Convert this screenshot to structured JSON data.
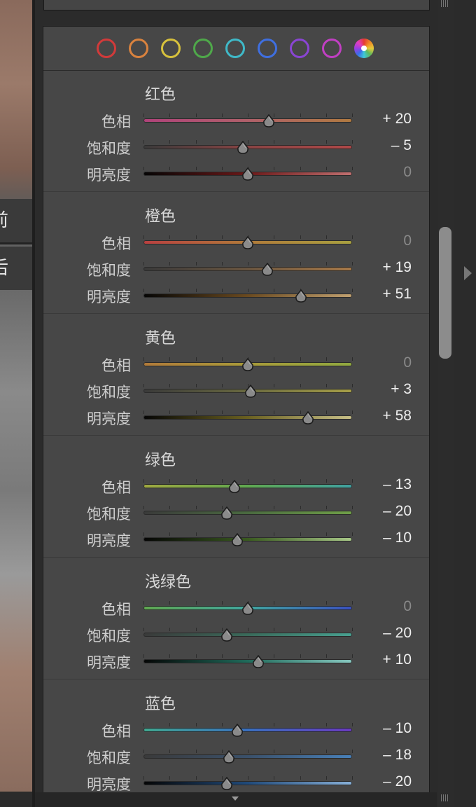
{
  "photo_labels": [
    "前",
    "后"
  ],
  "color_swatches": [
    {
      "name": "red",
      "color": "#d23a3a"
    },
    {
      "name": "orange",
      "color": "#d9823e"
    },
    {
      "name": "yellow",
      "color": "#d7c13c"
    },
    {
      "name": "green",
      "color": "#4fa84a"
    },
    {
      "name": "aqua",
      "color": "#3fb9c8"
    },
    {
      "name": "blue",
      "color": "#3f6fe0"
    },
    {
      "name": "purple",
      "color": "#8a45d4"
    },
    {
      "name": "magenta",
      "color": "#c13fc3"
    },
    {
      "name": "all",
      "color": "conic"
    }
  ],
  "groups": [
    {
      "title": "红色",
      "rows": [
        {
          "label": "色相",
          "value": "+ 20",
          "v": 20,
          "gradient": [
            "#b0427a",
            "#b0606a",
            "#b07a40"
          ]
        },
        {
          "label": "饱和度",
          "value": "– 5",
          "v": -5,
          "gradient": [
            "#3a3a3a",
            "#8a4444",
            "#b04848"
          ]
        },
        {
          "label": "明亮度",
          "value": "0",
          "v": 0,
          "gradient": [
            "#050505",
            "#6a1818",
            "#c07070"
          ]
        }
      ]
    },
    {
      "title": "橙色",
      "rows": [
        {
          "label": "色相",
          "value": "0",
          "v": 0,
          "gradient": [
            "#b84040",
            "#b07a3a",
            "#a8a040"
          ]
        },
        {
          "label": "饱和度",
          "value": "+ 19",
          "v": 19,
          "gradient": [
            "#3a3a3a",
            "#6a5540",
            "#a87a48"
          ]
        },
        {
          "label": "明亮度",
          "value": "+ 51",
          "v": 51,
          "gradient": [
            "#050505",
            "#6a4a20",
            "#c0a070"
          ]
        }
      ]
    },
    {
      "title": "黄色",
      "rows": [
        {
          "label": "色相",
          "value": "0",
          "v": 0,
          "gradient": [
            "#b07a3a",
            "#a89a3a",
            "#90a840"
          ]
        },
        {
          "label": "饱和度",
          "value": "+ 3",
          "v": 3,
          "gradient": [
            "#3a3a3a",
            "#6a6a40",
            "#a8a048"
          ]
        },
        {
          "label": "明亮度",
          "value": "+ 58",
          "v": 58,
          "gradient": [
            "#050505",
            "#6a6020",
            "#c8c088"
          ]
        }
      ]
    },
    {
      "title": "绿色",
      "rows": [
        {
          "label": "色相",
          "value": "– 13",
          "v": -13,
          "gradient": [
            "#a0a840",
            "#60a850",
            "#40a0a0"
          ]
        },
        {
          "label": "饱和度",
          "value": "– 20",
          "v": -20,
          "gradient": [
            "#3a3a3a",
            "#4a6a40",
            "#70a048"
          ]
        },
        {
          "label": "明亮度",
          "value": "– 10",
          "v": -10,
          "gradient": [
            "#050505",
            "#3a5a20",
            "#a8c888"
          ]
        }
      ]
    },
    {
      "title": "浅绿色",
      "rows": [
        {
          "label": "色相",
          "value": "0",
          "v": 0,
          "gradient": [
            "#60a850",
            "#40a8a0",
            "#3a50c0"
          ]
        },
        {
          "label": "饱和度",
          "value": "– 20",
          "v": -20,
          "gradient": [
            "#3a3a3a",
            "#3a6a5a",
            "#48a090"
          ]
        },
        {
          "label": "明亮度",
          "value": "+ 10",
          "v": 10,
          "gradient": [
            "#050505",
            "#206a5a",
            "#88c8c0"
          ]
        }
      ]
    },
    {
      "title": "蓝色",
      "rows": [
        {
          "label": "色相",
          "value": "– 10",
          "v": -10,
          "gradient": [
            "#40a890",
            "#3a70c0",
            "#6a3ac0"
          ]
        },
        {
          "label": "饱和度",
          "value": "– 18",
          "v": -18,
          "gradient": [
            "#3a3a3a",
            "#3a506a",
            "#4880b8"
          ]
        },
        {
          "label": "明亮度",
          "value": "– 20",
          "v": -20,
          "gradient": [
            "#050505",
            "#204a7a",
            "#88b0d8"
          ]
        }
      ]
    }
  ]
}
